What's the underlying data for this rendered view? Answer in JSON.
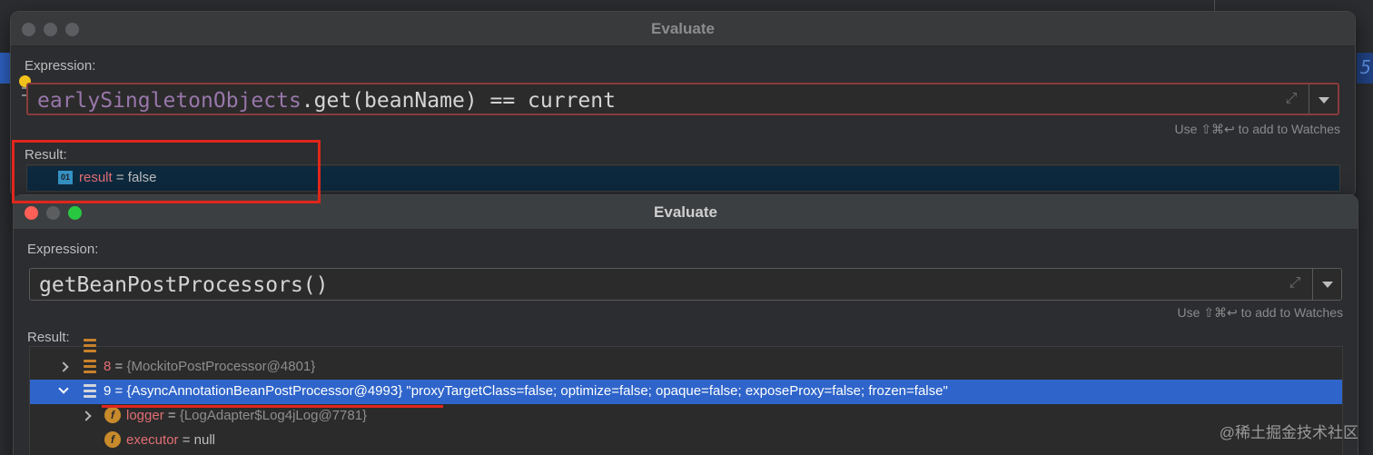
{
  "background": {
    "right_edge_text": "5"
  },
  "window1": {
    "title": "Evaluate",
    "expression_label": "Expression:",
    "expression": {
      "field": "earlySingletonObjects",
      "rest": ".get(beanName) == current"
    },
    "watch_hint": "Use ⇧⌘↩ to add to Watches",
    "result_label": "Result:",
    "result_row": {
      "icon": "boolean-icon",
      "icon_text": "01",
      "name": "result",
      "eq": " = ",
      "value": "false"
    }
  },
  "window2": {
    "title": "Evaluate",
    "expression_label": "Expression:",
    "expression": "getBeanPostProcessors()",
    "watch_hint": "Use ⇧⌘↩ to add to Watches",
    "result_label": "Result:",
    "rows": [
      {
        "name": "8",
        "eq": " = ",
        "ref": "{MockitoPostProcessor@4801}",
        "str": ""
      },
      {
        "name": "9",
        "eq": " = ",
        "ref": "{AsyncAnnotationBeanPostProcessor@4993}",
        "str": " \"proxyTargetClass=false; optimize=false; opaque=false; exposeProxy=false; frozen=false\""
      },
      {
        "name": "logger",
        "eq": " = ",
        "ref": "{LogAdapter$Log4jLog@7781}",
        "str": ""
      },
      {
        "name": "executor",
        "eq": " = ",
        "ref": "",
        "str": "",
        "value": "null"
      }
    ]
  },
  "watermark": "@稀土掘金技术社区",
  "colors": {
    "selection": "#2f65ca",
    "annotation": "#e0261b",
    "field_name": "#9876aa",
    "var_name": "#e26e73"
  }
}
